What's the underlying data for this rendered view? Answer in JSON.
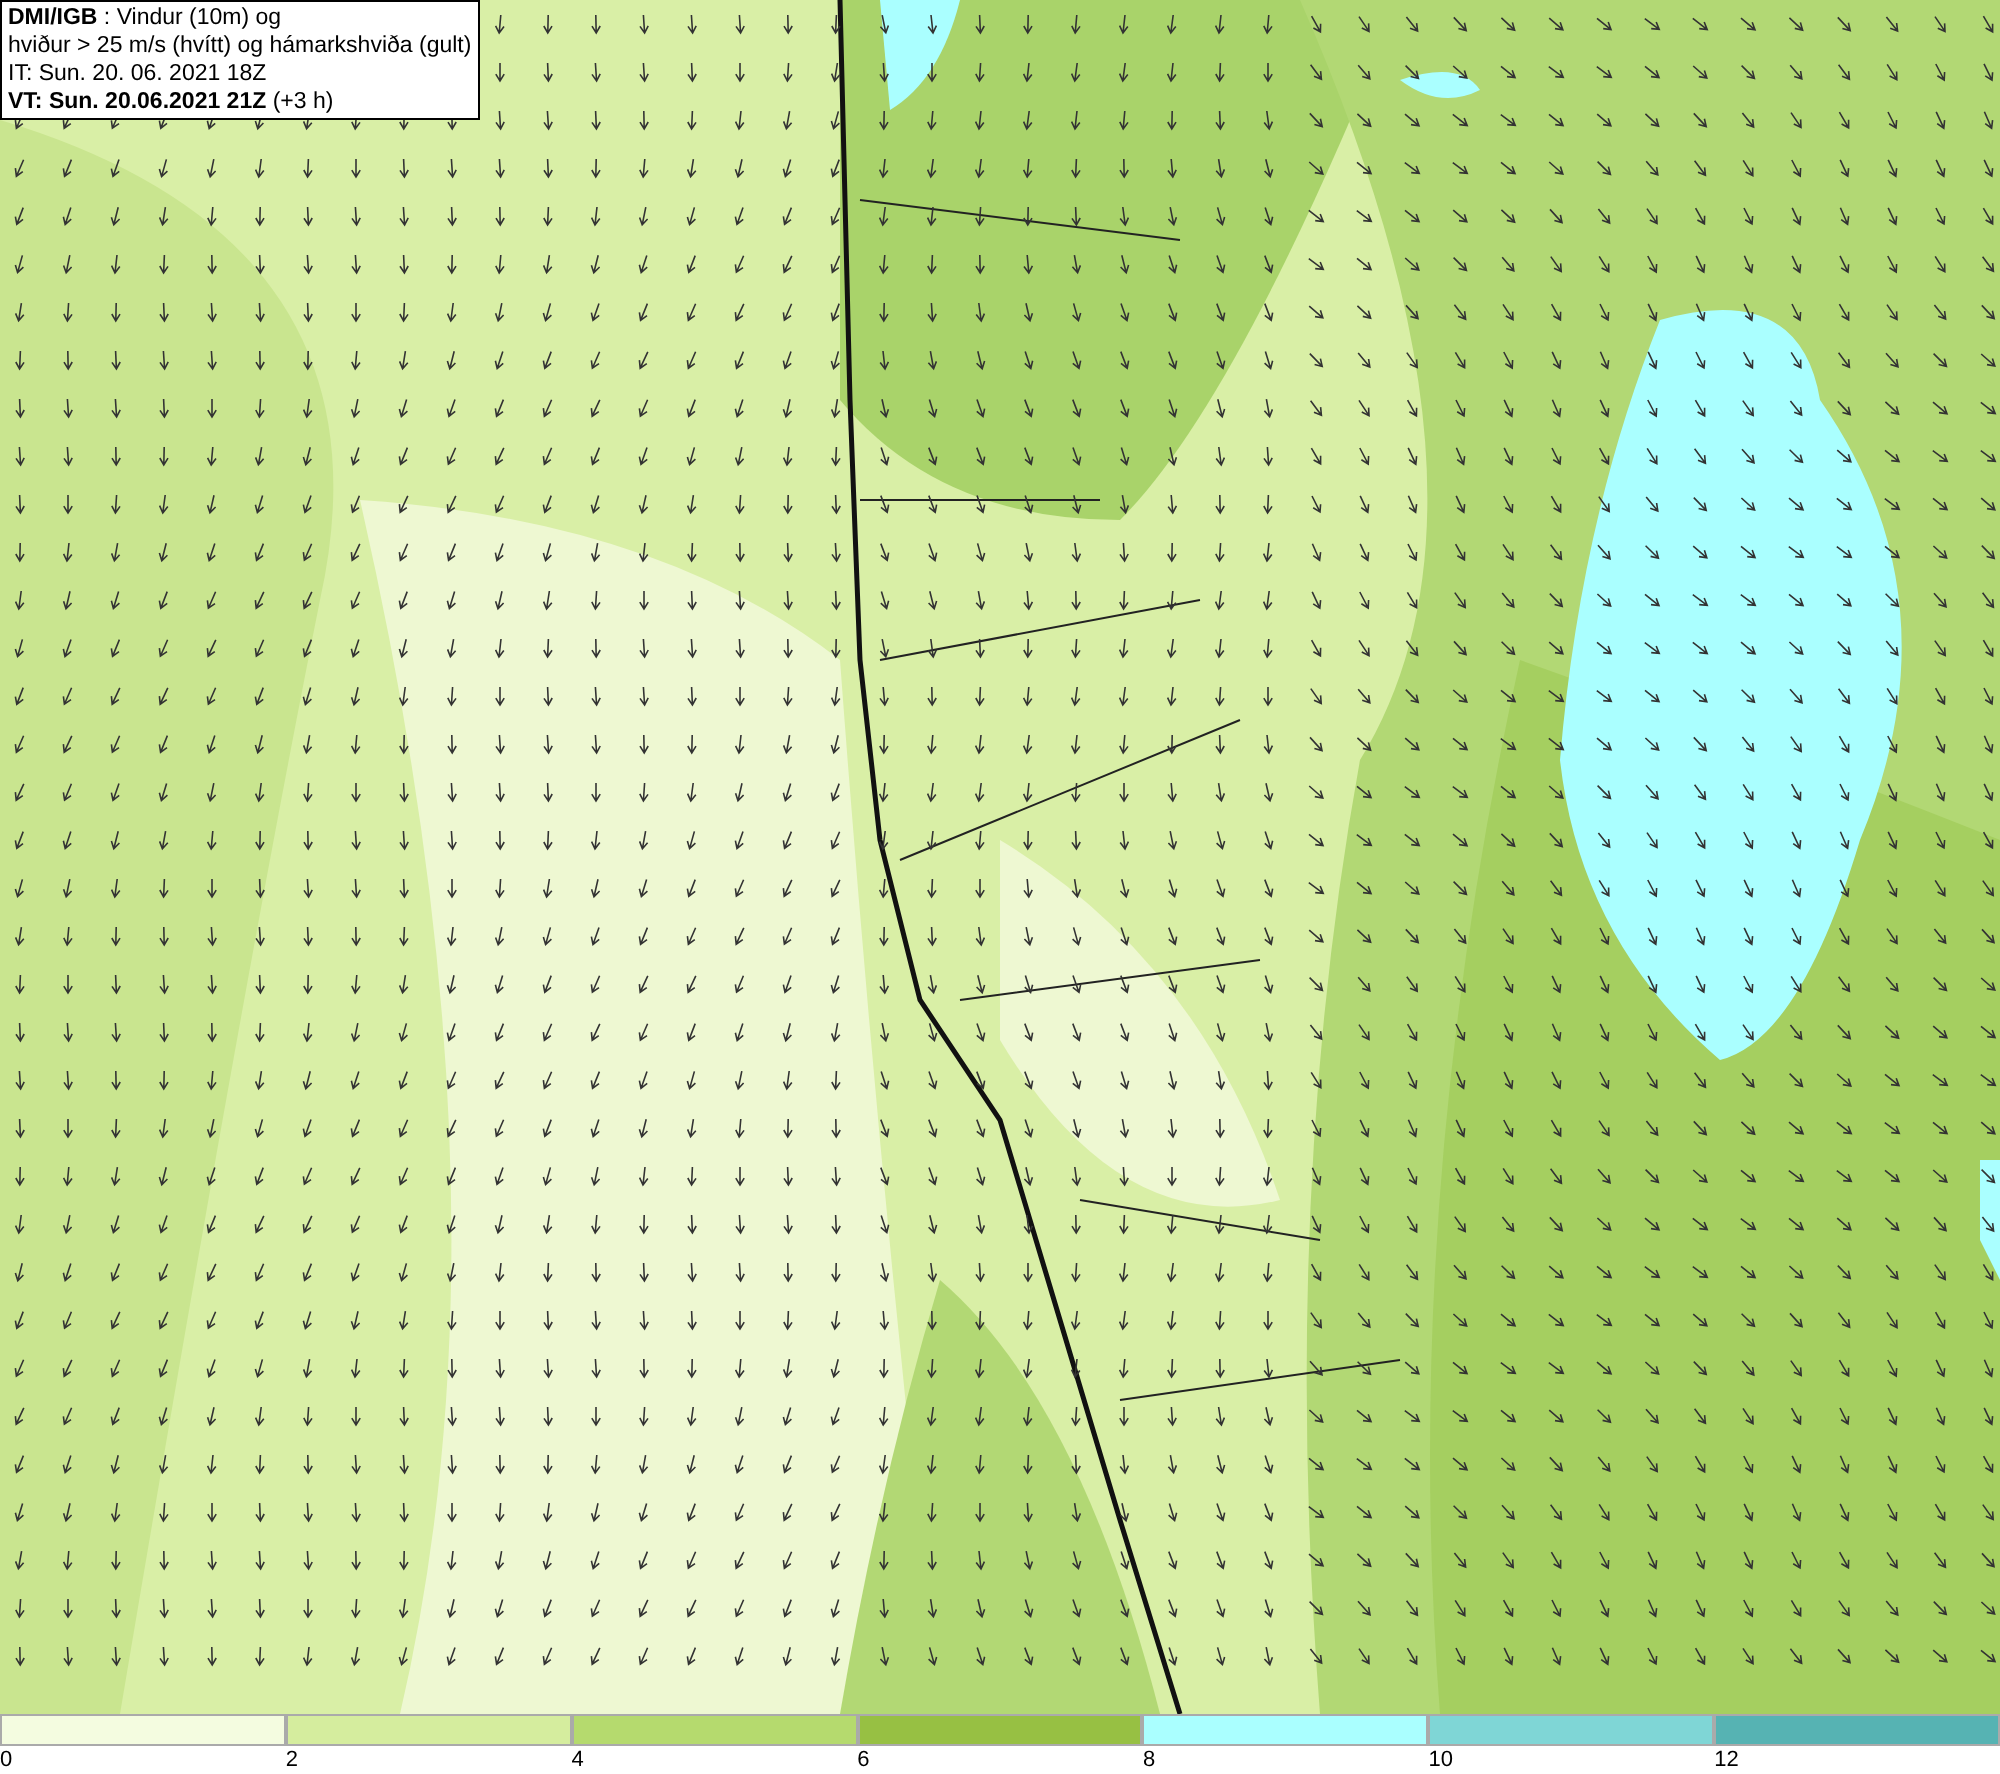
{
  "title_box": {
    "lines": [
      "**DMI/IGB** : Vindur (10m) og",
      "hviður > 25 m/s (hvítt) og hámarkshviða (gult)",
      "IT: Sun. 20. 06. 2021 18Z",
      "**VT: Sun. 20.06.2021 21Z** (+3 h)"
    ]
  },
  "legend": {
    "bins": [
      {
        "label": "0",
        "color": "#f4fce0"
      },
      {
        "label": "2",
        "color": "#d5ed9e"
      },
      {
        "label": "4",
        "color": "#b5da6e"
      },
      {
        "label": "6",
        "color": "#97c043"
      },
      {
        "label": "8",
        "color": "#aaffff"
      },
      {
        "label": "10",
        "color": "#7fd6d6"
      },
      {
        "label": "12",
        "color": "#56b3b3"
      }
    ]
  }
}
